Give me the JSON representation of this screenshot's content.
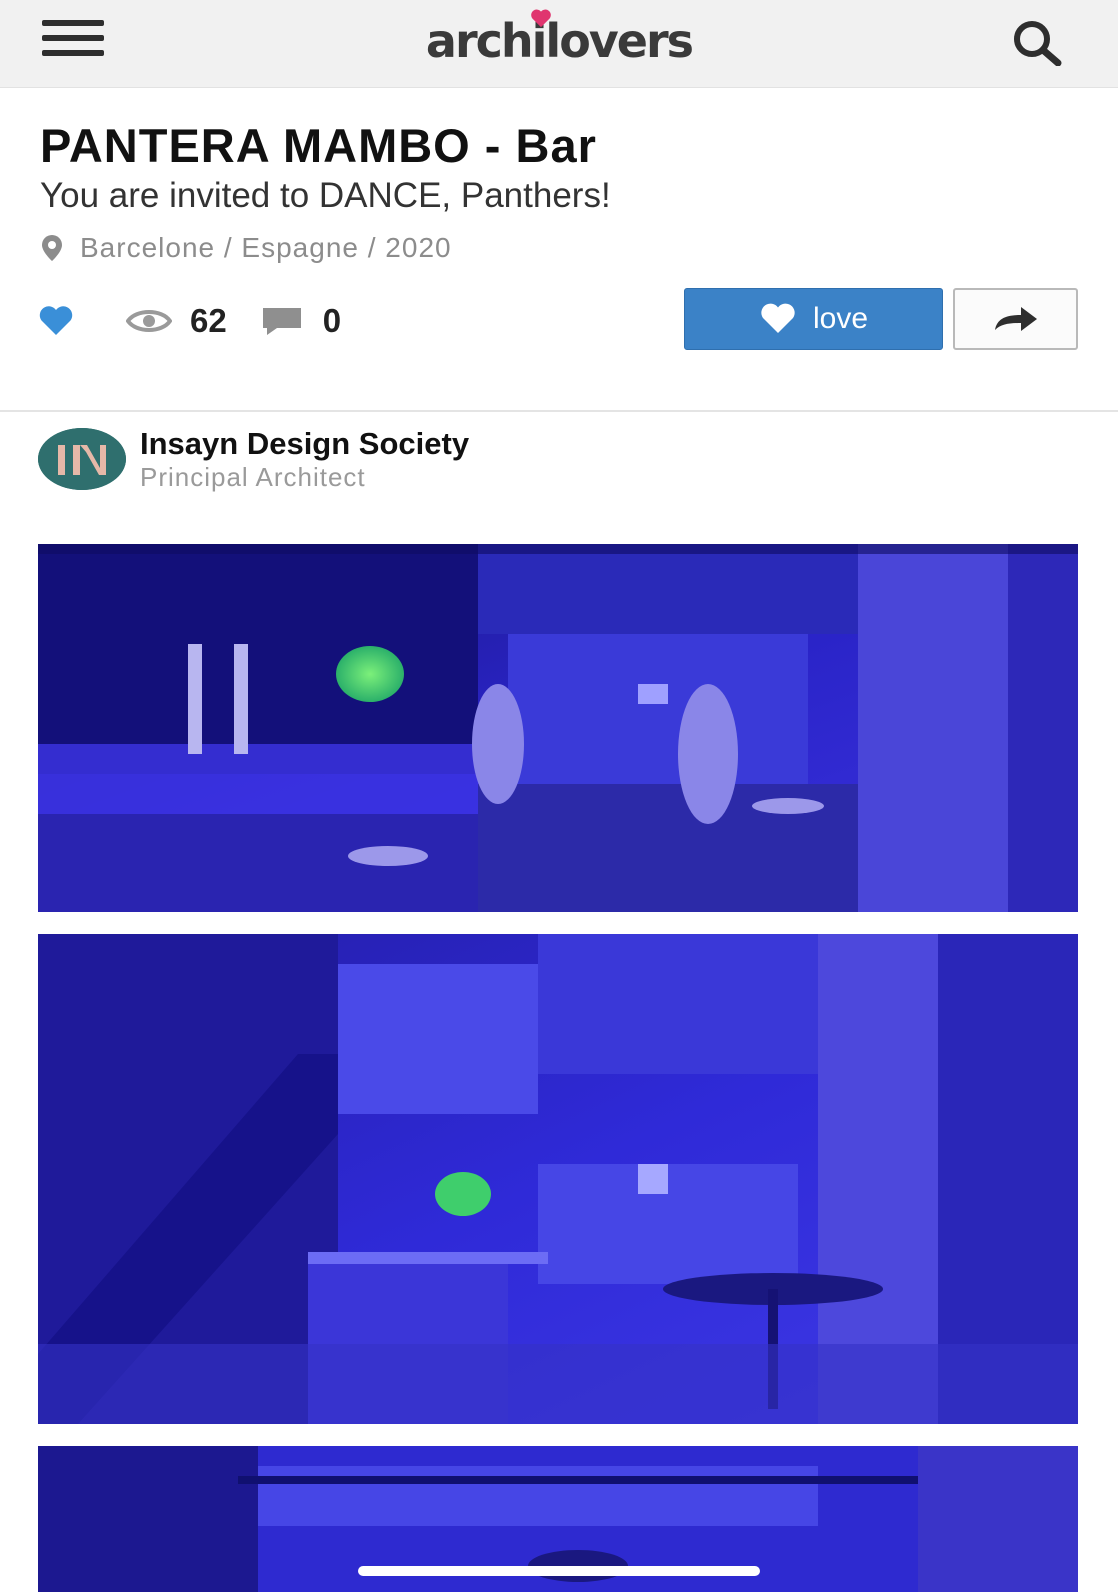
{
  "header": {
    "brand": "archilovers",
    "menu_icon": "hamburger-menu-icon",
    "search_icon": "search-icon"
  },
  "project": {
    "title": "PANTERA MAMBO - Bar",
    "subtitle": "You are invited to DANCE, Panthers!",
    "location": "Barcelone / Espagne / 2020"
  },
  "stats": {
    "views": "62",
    "comments": "0"
  },
  "actions": {
    "love_label": "love",
    "share_icon": "share-arrow-icon"
  },
  "author": {
    "name": "Insayn Design Society",
    "role": "Principal Architect",
    "avatar_initials": "IN"
  },
  "colors": {
    "accent_blue": "#3b82c7",
    "heart_blue": "#3a8fd8",
    "logo_heart": "#e0356f",
    "avatar_bg": "#2f6f6e",
    "photo_tint": "#2a1fd0"
  }
}
